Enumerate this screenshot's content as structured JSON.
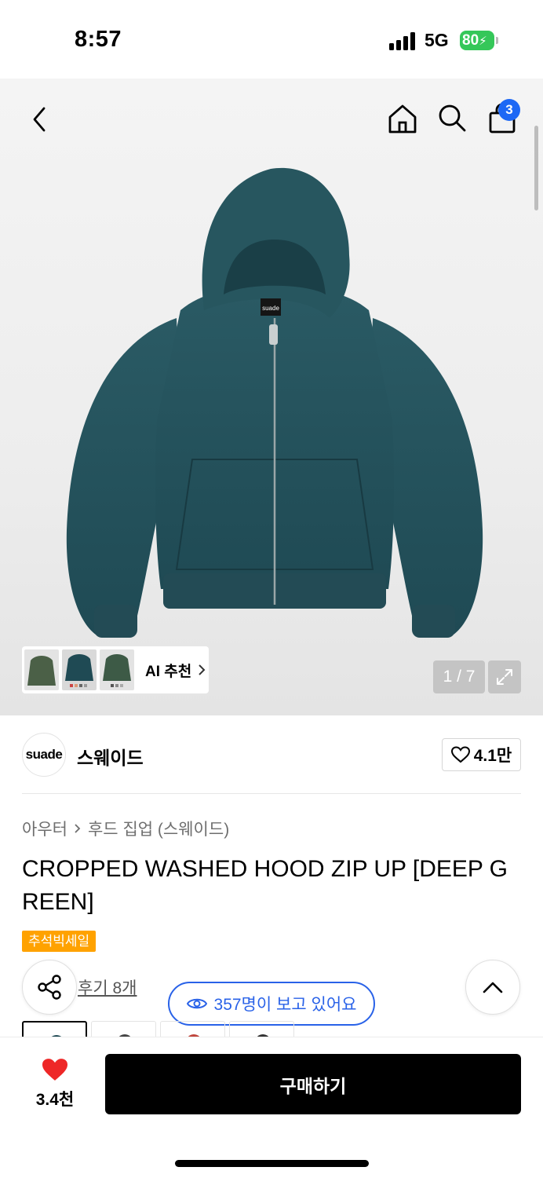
{
  "status_bar": {
    "time": "8:57",
    "network": "5G",
    "battery": "80"
  },
  "header": {
    "cart_count": "3"
  },
  "gallery": {
    "brand_tag": "suade",
    "ai_recommend_label": "AI 추천",
    "page_indicator": "1 / 7",
    "product_color": "#24505a"
  },
  "brand": {
    "logo_text": "suade",
    "name": "스웨이드",
    "likes": "4.1만"
  },
  "breadcrumb": {
    "category": "아우터",
    "subcategory": "후드 집업 (스웨이드)"
  },
  "product": {
    "title": "CROPPED WASHED HOOD ZIP UP [DEEP GREEN]",
    "sale_badge": "추석빅세일",
    "reviews_link": "후기 8개",
    "viewers": "357명이 보고 있어요"
  },
  "bottom_bar": {
    "wish_count": "3.4천",
    "buy_label": "구매하기"
  },
  "colors": {
    "accent_blue": "#2962e8",
    "sale_orange": "#ffa200",
    "heart_red": "#ee2727"
  }
}
